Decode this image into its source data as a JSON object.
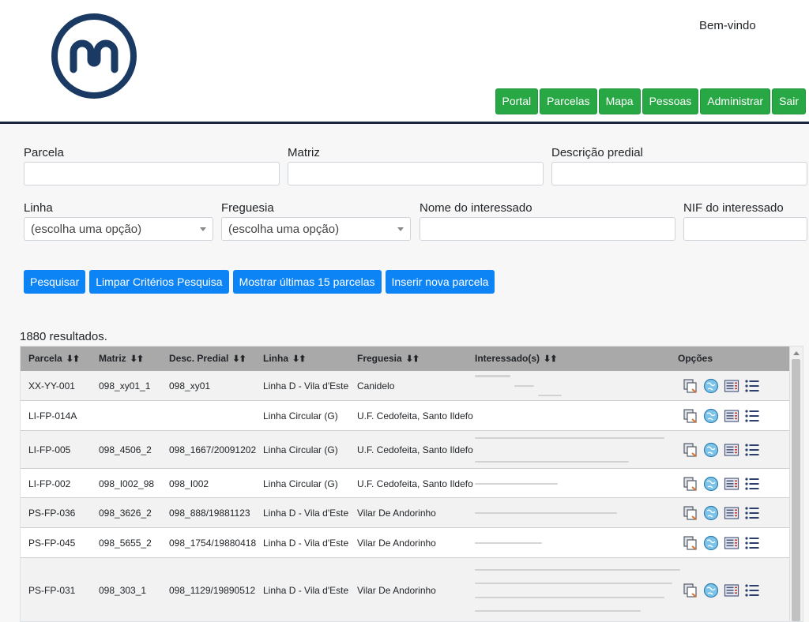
{
  "header": {
    "welcome": "Bem-vindo",
    "nav": [
      "Portal",
      "Parcelas",
      "Mapa",
      "Pessoas",
      "Administrar",
      "Sair"
    ]
  },
  "colors": {
    "nav_green": "#28a745",
    "button_blue": "#0d84f5",
    "header_rule": "#1a2540",
    "logo_navy": "#1a3a63"
  },
  "form": {
    "parcela_label": "Parcela",
    "matriz_label": "Matriz",
    "descricao_label": "Descrição predial",
    "linha_label": "Linha",
    "linha_value": "(escolha uma opção)",
    "freguesia_label": "Freguesia",
    "freguesia_value": "(escolha uma opção)",
    "nome_label": "Nome do interessado",
    "nif_label": "NIF do interessado"
  },
  "buttons": {
    "search": "Pesquisar",
    "clear": "Limpar Critérios Pesquisa",
    "last15": "Mostrar últimas 15 parcelas",
    "insert": "Inserir nova parcela"
  },
  "results": {
    "count_text": "1880 resultados.",
    "columns": {
      "parcela": "Parcela",
      "matriz": "Matriz",
      "desc": "Desc. Predial",
      "linha": "Linha",
      "freguesia": "Freguesia",
      "interessados": "Interessado(s)",
      "opcoes": "Opções",
      "sort_glyph": "⬇⬆"
    },
    "rows": [
      {
        "parcela": "XX-YY-001",
        "matriz": "098_xy01_1",
        "desc": "098_xy01",
        "linha": "Linha D - Vila d'Este",
        "freguesia": "Canidelo"
      },
      {
        "parcela": "LI-FP-014A",
        "matriz": "",
        "desc": "",
        "linha": "Linha Circular (G)",
        "freguesia": "U.F. Cedofeita, Santo Ildefo"
      },
      {
        "parcela": "LI-FP-005",
        "matriz": "098_4506_2",
        "desc": "098_1667/20091202",
        "linha": "Linha Circular (G)",
        "freguesia": "U.F. Cedofeita, Santo Ildefo"
      },
      {
        "parcela": "LI-FP-002",
        "matriz": "098_I002_98",
        "desc": "098_I002",
        "linha": "Linha Circular (G)",
        "freguesia": "U.F. Cedofeita, Santo Ildefo"
      },
      {
        "parcela": "PS-FP-036",
        "matriz": "098_3626_2",
        "desc": "098_888/19881123",
        "linha": "Linha D - Vila d'Este",
        "freguesia": "Vilar De Andorinho"
      },
      {
        "parcela": "PS-FP-045",
        "matriz": "098_5655_2",
        "desc": "098_1754/19880418",
        "linha": "Linha D - Vila d'Este",
        "freguesia": "Vilar De Andorinho"
      },
      {
        "parcela": "PS-FP-031",
        "matriz": "098_303_1",
        "desc": "098_1129/19890512",
        "linha": "Linha D - Vila d'Este",
        "freguesia": "Vilar De Andorinho"
      }
    ]
  },
  "row_icons": [
    "copy-icon",
    "globe-icon",
    "document-list-icon",
    "list-icon"
  ]
}
